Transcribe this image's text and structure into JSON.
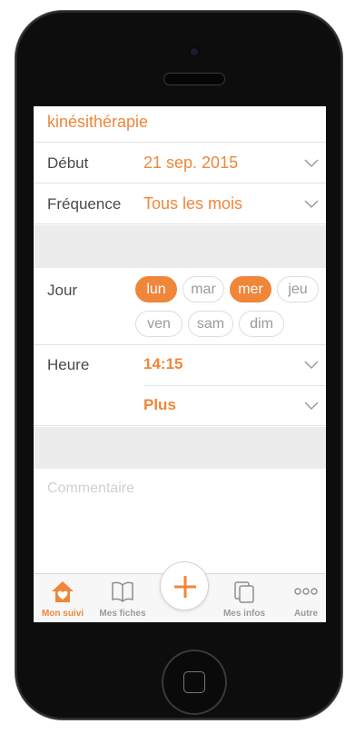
{
  "form": {
    "title": "kinésithérapie",
    "debut": {
      "label": "Début",
      "value": "21 sep. 2015"
    },
    "frequence": {
      "label": "Fréquence",
      "value": "Tous les mois"
    },
    "jour": {
      "label": "Jour",
      "days": [
        {
          "label": "lun",
          "selected": true
        },
        {
          "label": "mar",
          "selected": false
        },
        {
          "label": "mer",
          "selected": true
        },
        {
          "label": "jeu",
          "selected": false
        },
        {
          "label": "ven",
          "selected": false
        },
        {
          "label": "sam",
          "selected": false
        },
        {
          "label": "dim",
          "selected": false
        }
      ]
    },
    "heure": {
      "label": "Heure",
      "value": "14:15",
      "more": "Plus"
    },
    "commentaire": {
      "placeholder": "Commentaire"
    }
  },
  "tabbar": {
    "items": [
      {
        "label": "Mon suivi",
        "icon": "home-heart-icon",
        "active": true
      },
      {
        "label": "Mes fiches",
        "icon": "book-icon",
        "active": false
      },
      {
        "label": "Mes infos",
        "icon": "documents-icon",
        "active": false
      },
      {
        "label": "Autre",
        "icon": "more-dots-icon",
        "active": false
      }
    ],
    "add_icon": "plus-icon"
  },
  "colors": {
    "accent": "#f0863a",
    "label": "#4a4a4a",
    "band": "#ececec"
  }
}
